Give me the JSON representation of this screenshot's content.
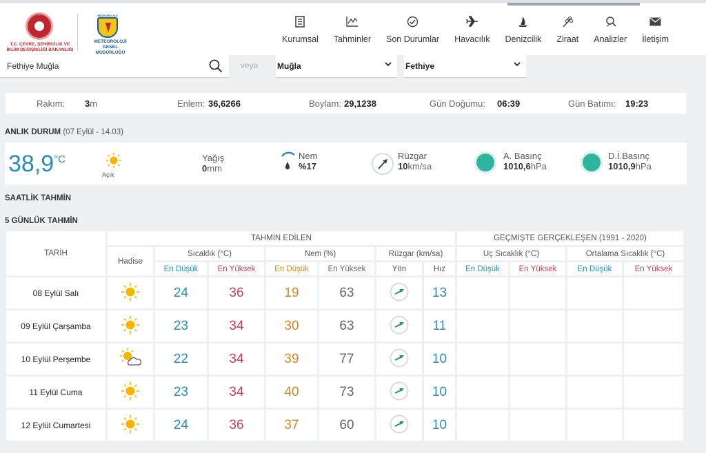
{
  "header": {
    "ministry_text": "T.C. ÇEVRE, ŞEHİRCİLİK VE İKLİM DEĞİŞİKLİĞİ BAKANLIĞI",
    "mgm_text": "METEOROLOJİ GENEL MÜDÜRLÜĞÜ",
    "nav": [
      {
        "label": "Kurumsal",
        "icon": "document-icon"
      },
      {
        "label": "Tahminler",
        "icon": "chart-icon"
      },
      {
        "label": "Son Durumlar",
        "icon": "check-circle-icon"
      },
      {
        "label": "Havacılık",
        "icon": "airplane-icon"
      },
      {
        "label": "Denizcilik",
        "icon": "sailboat-icon"
      },
      {
        "label": "Ziraat",
        "icon": "wheat-icon"
      },
      {
        "label": "Analizler",
        "icon": "magnifier-icon"
      },
      {
        "label": "İletişim",
        "icon": "envelope-icon"
      }
    ]
  },
  "search": {
    "value": "Fethiye Muğla",
    "or_label": "veya",
    "province": "Muğla",
    "district": "Fethiye"
  },
  "info": {
    "rakim_label": "Rakım:",
    "rakim_value": "3",
    "rakim_unit": "m",
    "enlem_label": "Enlem:",
    "enlem_value": "36,6266",
    "boylam_label": "Boylam:",
    "boylam_value": "29,1238",
    "dogum_label": "Gün Doğumu:",
    "dogum_value": "06:39",
    "batim_label": "Gün Batımı:",
    "batim_value": "19:23"
  },
  "current": {
    "title": "ANLIK DURUM",
    "time": "(07 Eylül - 14.03)",
    "temp": "38,9",
    "temp_unit": "°C",
    "condition": "Açık",
    "yagis_label": "Yağış",
    "yagis_value": "0",
    "yagis_unit": "mm",
    "nem_label": "Nem",
    "nem_value": "%17",
    "ruzgar_label": "Rüzgar",
    "ruzgar_value": "10",
    "ruzgar_unit": "km/sa",
    "abasinc_label": "A. Basınç",
    "abasinc_value": "1010,6",
    "abasinc_unit": "hPa",
    "dibasinc_label": "D.İ.Basınç",
    "dibasinc_value": "1010,9",
    "dibasinc_unit": "hPa"
  },
  "sections": {
    "hourly": "SAATLİK TAHMİN",
    "five_day": "5 GÜNLÜK TAHMİN"
  },
  "forecast": {
    "col_date": "TARİH",
    "col_forecast": "TAHMİN EDİLEN",
    "col_past": "GEÇMİŞTE GERÇEKLEŞEN (1991 - 2020)",
    "col_hadise": "Hadise",
    "col_temp": "Sıcaklık (°C)",
    "col_nem": "Nem (%)",
    "col_wind": "Rüzgar (km/sa)",
    "col_extreme": "Uç Sıcaklık (°C)",
    "col_avg": "Ortalama Sıcaklık (°C)",
    "min": "En Düşük",
    "max": "En Yüksek",
    "dir": "Yön",
    "speed": "Hız",
    "rows": [
      {
        "date": "08 Eylül Salı",
        "icon": "sun-icon",
        "tmin": "24",
        "tmax": "36",
        "nmin": "19",
        "nmax": "63",
        "speed": "13"
      },
      {
        "date": "09 Eylül Çarşamba",
        "icon": "sun-icon",
        "tmin": "23",
        "tmax": "34",
        "nmin": "30",
        "nmax": "63",
        "speed": "11"
      },
      {
        "date": "10 Eylül Perşembe",
        "icon": "sun-cloud-icon",
        "tmin": "22",
        "tmax": "34",
        "nmin": "39",
        "nmax": "77",
        "speed": "10"
      },
      {
        "date": "11 Eylül Cuma",
        "icon": "sun-icon",
        "tmin": "23",
        "tmax": "34",
        "nmin": "40",
        "nmax": "73",
        "speed": "10"
      },
      {
        "date": "12 Eylül Cumartesi",
        "icon": "sun-icon",
        "tmin": "24",
        "tmax": "36",
        "nmin": "37",
        "nmax": "60",
        "speed": "10"
      }
    ]
  },
  "colors": {
    "accent": "#2a8fb8",
    "max": "#c8414f",
    "min_humidity": "#d58a1b",
    "pressure": "#2fb59f"
  }
}
